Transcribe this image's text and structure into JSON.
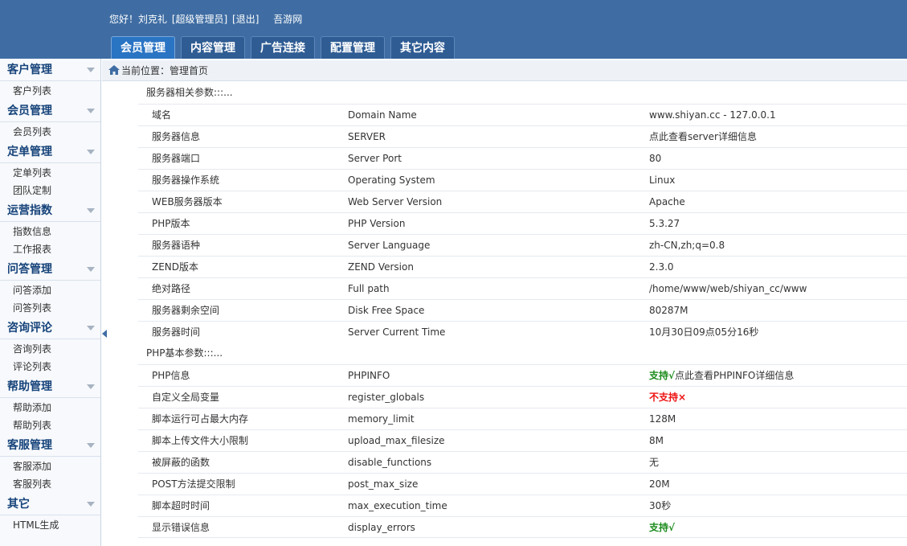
{
  "header": {
    "greeting": "您好！刘克礼",
    "role": "[超级管理员]",
    "logout": "[退出]",
    "site": "吾游网",
    "tabs": [
      "会员管理",
      "内容管理",
      "广告连接",
      "配置管理",
      "其它内容"
    ]
  },
  "sidebar": [
    {
      "title": "客户管理",
      "items": [
        "客户列表"
      ]
    },
    {
      "title": "会员管理",
      "items": [
        "会员列表"
      ]
    },
    {
      "title": "定单管理",
      "items": [
        "定单列表",
        "团队定制"
      ]
    },
    {
      "title": "运营指数",
      "items": [
        "指数信息",
        "工作报表"
      ]
    },
    {
      "title": "问答管理",
      "items": [
        "问答添加",
        "问答列表"
      ]
    },
    {
      "title": "咨询评论",
      "items": [
        "咨询列表",
        "评论列表"
      ]
    },
    {
      "title": "帮助管理",
      "items": [
        "帮助添加",
        "帮助列表"
      ]
    },
    {
      "title": "客服管理",
      "items": [
        "客服添加",
        "客服列表"
      ]
    },
    {
      "title": "其它",
      "items": [
        "HTML生成"
      ]
    }
  ],
  "breadcrumb": {
    "text": "当前位置：管理首页"
  },
  "server_section": {
    "title": "服务器相关参数:::...",
    "rows": [
      [
        "域名",
        "Domain Name",
        "www.shiyan.cc - 127.0.0.1"
      ],
      [
        "服务器信息",
        "SERVER",
        "点此查看server详细信息"
      ],
      [
        "服务器端口",
        "Server Port",
        "80"
      ],
      [
        "服务器操作系统",
        "Operating System",
        "Linux"
      ],
      [
        "WEB服务器版本",
        "Web Server Version",
        "Apache"
      ],
      [
        "PHP版本",
        "PHP Version",
        "5.3.27"
      ],
      [
        "服务器语种",
        "Server Language",
        "zh-CN,zh;q=0.8"
      ],
      [
        "ZEND版本",
        "ZEND Version",
        "2.3.0"
      ],
      [
        "绝对路径",
        "Full path",
        "/home/www/web/shiyan_cc/www"
      ],
      [
        "服务器剩余空间",
        "Disk Free Space",
        "80287M"
      ],
      [
        "服务器时间",
        "Server Current Time",
        "10月30日09点05分16秒"
      ]
    ]
  },
  "php_section": {
    "title": "PHP基本参数:::...",
    "rows": [
      [
        "PHP信息",
        "PHPINFO",
        "支持√",
        "点此查看PHPINFO详细信息"
      ],
      [
        "自定义全局变量",
        "register_globals",
        "不支持×",
        ""
      ],
      [
        "脚本运行可占最大内存",
        "memory_limit",
        "128M",
        ""
      ],
      [
        "脚本上传文件大小限制",
        "upload_max_filesize",
        "8M",
        ""
      ],
      [
        "被屏蔽的函数",
        "disable_functions",
        "无",
        ""
      ],
      [
        "POST方法提交限制",
        "post_max_size",
        "20M",
        ""
      ],
      [
        "脚本超时时间",
        "max_execution_time",
        "30秒",
        ""
      ],
      [
        "显示错误信息",
        "display_errors",
        "支持√",
        ""
      ]
    ]
  }
}
